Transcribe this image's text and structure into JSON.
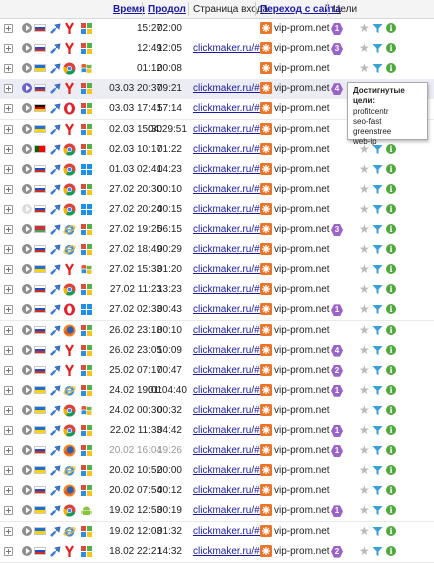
{
  "header": {
    "time": "Время",
    "duration": "Продолжительность",
    "entry_page": "Страница входа",
    "referrer": "Переход с сайта",
    "goals": "Цели"
  },
  "tooltip": {
    "title": "Достигнутые цели:",
    "items": [
      "profitcentr",
      "seo-fast",
      "greenstree",
      "web-ip"
    ]
  },
  "rows": [
    {
      "time": "15:27",
      "duration": "02:00",
      "entry": "",
      "site": "vip-prom.net",
      "goals": "1",
      "flag": "ru",
      "browser": "yandex",
      "os": "win7",
      "play": "grey",
      "dim": false,
      "hl": false
    },
    {
      "time": "12:49",
      "duration": "12:05",
      "entry": "clickmaker.ru/#1",
      "site": "vip-prom.net",
      "goals": "3",
      "flag": "ru",
      "browser": "yandex",
      "os": "win7",
      "play": "grey",
      "dim": false,
      "hl": false
    },
    {
      "time": "01:12",
      "duration": "00:08",
      "entry": "",
      "site": "vip-prom.net",
      "goals": "",
      "flag": "ua",
      "browser": "chrome",
      "os": "winxp",
      "play": "grey",
      "dim": false,
      "hl": false
    },
    {
      "time": "03.03 20:37",
      "duration": "09:21",
      "entry": "clickmaker.ru/#1",
      "site": "vip-prom.net",
      "goals": "4",
      "flag": "ru",
      "browser": "yandex",
      "os": "win7",
      "play": "blue",
      "dim": false,
      "hl": true
    },
    {
      "time": "03.03 17:41",
      "duration": "57:14",
      "entry": "clickmaker.ru/#1",
      "site": "vip-prom.net",
      "goals": "",
      "flag": "de",
      "browser": "opera",
      "os": "win7",
      "play": "grey",
      "dim": false,
      "hl": false
    },
    {
      "time": "02.03 15:30",
      "duration": "04:29:51",
      "entry": "clickmaker.ru/#1",
      "site": "vip-prom.net",
      "goals": "",
      "flag": "ua",
      "browser": "yandex",
      "os": "win7",
      "play": "grey",
      "dim": false,
      "hl": false
    },
    {
      "time": "02.03 10:17",
      "duration": "01:22",
      "entry": "clickmaker.ru/#1",
      "site": "vip-prom.net",
      "goals": "",
      "flag": "pt",
      "browser": "chrome",
      "os": "win7",
      "play": "grey",
      "dim": false,
      "hl": false
    },
    {
      "time": "01.03 02:41",
      "duration": "04:23",
      "entry": "clickmaker.ru/#1",
      "site": "vip-prom.net",
      "goals": "",
      "flag": "ru",
      "browser": "chrome",
      "os": "win8",
      "play": "grey",
      "dim": false,
      "hl": false
    },
    {
      "time": "27.02 20:30",
      "duration": "00:10",
      "entry": "clickmaker.ru/#1",
      "site": "vip-prom.net",
      "goals": "",
      "flag": "ru",
      "browser": "chrome",
      "os": "win7",
      "play": "grey",
      "dim": false,
      "hl": false
    },
    {
      "time": "27.02 20:24",
      "duration": "00:15",
      "entry": "clickmaker.ru/#1",
      "site": "vip-prom.net",
      "goals": "",
      "flag": "ru",
      "browser": "chrome",
      "os": "win8",
      "play": "faint",
      "dim": false,
      "hl": false
    },
    {
      "time": "27.02 19:25",
      "duration": "06:15",
      "entry": "clickmaker.ru/#1",
      "site": "vip-prom.net",
      "goals": "3",
      "flag": "by",
      "browser": "ie",
      "os": "win7",
      "play": "grey",
      "dim": false,
      "hl": false
    },
    {
      "time": "27.02 18:49",
      "duration": "00:29",
      "entry": "clickmaker.ru/#1",
      "site": "vip-prom.net",
      "goals": "",
      "flag": "ru",
      "browser": "ie",
      "os": "win7",
      "play": "grey",
      "dim": false,
      "hl": false
    },
    {
      "time": "27.02 15:33",
      "duration": "01:20",
      "entry": "clickmaker.ru/#1",
      "site": "vip-prom.net",
      "goals": "",
      "flag": "ua",
      "browser": "yandex",
      "os": "winxp",
      "play": "grey",
      "dim": false,
      "hl": false
    },
    {
      "time": "27.02 11:23",
      "duration": "13:23",
      "entry": "clickmaker.ru/#1",
      "site": "vip-prom.net",
      "goals": "",
      "flag": "ru",
      "browser": "chrome",
      "os": "win7",
      "play": "grey",
      "dim": false,
      "hl": false
    },
    {
      "time": "27.02 02:33",
      "duration": "00:43",
      "entry": "clickmaker.ru/#1",
      "site": "vip-prom.net",
      "goals": "1",
      "flag": "ru",
      "browser": "opera",
      "os": "win8",
      "play": "grey",
      "dim": false,
      "hl": false
    },
    {
      "time": "26.02 23:18",
      "duration": "00:10",
      "entry": "clickmaker.ru/#1",
      "site": "vip-prom.net",
      "goals": "",
      "flag": "ru",
      "browser": "firefox",
      "os": "win7",
      "play": "grey",
      "dim": false,
      "hl": false
    },
    {
      "time": "26.02 23:05",
      "duration": "10:09",
      "entry": "clickmaker.ru/#1",
      "site": "vip-prom.net",
      "goals": "4",
      "flag": "ru",
      "browser": "yandex",
      "os": "win7",
      "play": "grey",
      "dim": false,
      "hl": false
    },
    {
      "time": "25.02 07:17",
      "duration": "00:47",
      "entry": "clickmaker.ru/#1",
      "site": "vip-prom.net",
      "goals": "2",
      "flag": "ru",
      "browser": "yandex",
      "os": "win7",
      "play": "grey",
      "dim": false,
      "hl": false
    },
    {
      "time": "24.02 19:01",
      "duration": "01:04:40",
      "entry": "clickmaker.ru/#1",
      "site": "vip-prom.net",
      "goals": "1",
      "flag": "ua",
      "browser": "ie",
      "os": "win7",
      "play": "grey",
      "dim": false,
      "hl": false
    },
    {
      "time": "24.02 00:30",
      "duration": "00:32",
      "entry": "clickmaker.ru/#1",
      "site": "vip-prom.net",
      "goals": "",
      "flag": "ua",
      "browser": "chrome",
      "os": "winxp",
      "play": "grey",
      "dim": false,
      "hl": false
    },
    {
      "time": "22.02 11:33",
      "duration": "04:42",
      "entry": "clickmaker.ru/#1",
      "site": "vip-prom.net",
      "goals": "1",
      "flag": "ua",
      "browser": "chrome",
      "os": "win7",
      "play": "grey",
      "dim": false,
      "hl": false
    },
    {
      "time": "20.02 16:04",
      "duration": "19:26",
      "entry": "clickmaker.ru/#1",
      "site": "vip-prom.net",
      "goals": "1",
      "flag": "ru",
      "browser": "firefox",
      "os": "win7",
      "play": "grey",
      "dim": true,
      "hl": false
    },
    {
      "time": "20.02 10:52",
      "duration": "00:00",
      "entry": "clickmaker.ru/#1",
      "site": "vip-prom.net",
      "goals": "",
      "flag": "ua",
      "browser": "ie",
      "os": "win7",
      "play": "grey",
      "dim": false,
      "hl": false
    },
    {
      "time": "20.02 07:54",
      "duration": "00:12",
      "entry": "clickmaker.ru/#1",
      "site": "vip-prom.net",
      "goals": "",
      "flag": "ru",
      "browser": "firefox",
      "os": "win7",
      "play": "grey",
      "dim": false,
      "hl": false
    },
    {
      "time": "19.02 12:53",
      "duration": "00:19",
      "entry": "clickmaker.ru/#1",
      "site": "vip-prom.net",
      "goals": "1",
      "flag": "ua",
      "browser": "chrome",
      "os": "android",
      "play": "grey",
      "dim": false,
      "hl": false
    },
    {
      "time": "19.02 12:03",
      "duration": "01:32",
      "entry": "clickmaker.ru/#1",
      "site": "vip-prom.net",
      "goals": "",
      "flag": "ua",
      "browser": "ie",
      "os": "win7",
      "play": "grey",
      "dim": false,
      "hl": false
    },
    {
      "time": "18.02 22:21",
      "duration": "14:32",
      "entry": "clickmaker.ru/#1",
      "site": "vip-prom.net",
      "goals": "2",
      "flag": "ru",
      "browser": "yandex",
      "os": "win7",
      "play": "grey",
      "dim": false,
      "hl": false
    }
  ],
  "colors": {
    "link": "#1a1aa6",
    "badge": "#9a63c8",
    "info": "#4ea83c",
    "funnel": "#3aa0d8",
    "site_icon": "#e9762b"
  },
  "icons": {
    "expand": "plus-box-icon",
    "play": "play-circle-icon",
    "referrer_arrow": "arrow-icon",
    "favorite": "star-icon",
    "filter": "funnel-icon",
    "info": "info-icon",
    "site": "site-logo-icon"
  }
}
